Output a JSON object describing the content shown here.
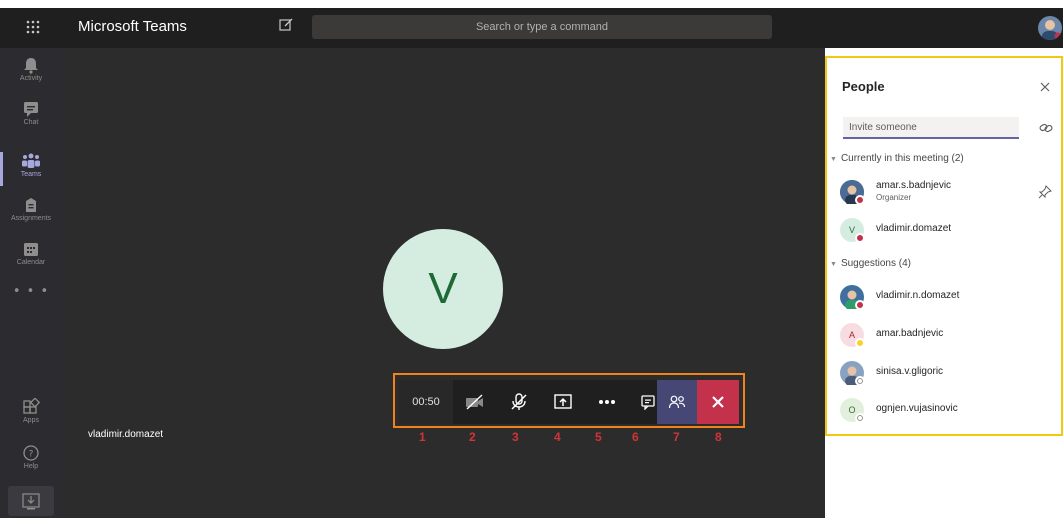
{
  "app": {
    "title": "Microsoft Teams",
    "search_placeholder": "Search or type a command"
  },
  "rail": {
    "items": [
      {
        "label": "Activity",
        "icon": "bell-icon"
      },
      {
        "label": "Chat",
        "icon": "chat-icon"
      },
      {
        "label": "Teams",
        "icon": "teams-icon",
        "active": true
      },
      {
        "label": "Assignments",
        "icon": "assignments-icon"
      },
      {
        "label": "Calendar",
        "icon": "calendar-icon"
      }
    ],
    "more": "• • •",
    "bottom": [
      {
        "label": "Apps",
        "icon": "apps-icon"
      },
      {
        "label": "Help",
        "icon": "help-icon"
      }
    ]
  },
  "stage": {
    "avatar_initial": "V",
    "participant_name": "vladimir.domazet"
  },
  "controls": {
    "timer": "00:50",
    "annotations": [
      "1",
      "2",
      "3",
      "4",
      "5",
      "6",
      "7",
      "8"
    ]
  },
  "people": {
    "title": "People",
    "invite_placeholder": "Invite someone",
    "in_meeting_header": "Currently in this meeting (2)",
    "in_meeting": [
      {
        "name": "amar.s.badnjevic",
        "role": "Organizer",
        "status": "busy"
      },
      {
        "name": "vladimir.domazet",
        "initial": "V",
        "status": "busy"
      }
    ],
    "suggestions_header": "Suggestions (4)",
    "suggestions": [
      {
        "name": "vladimir.n.domazet",
        "status": "busy"
      },
      {
        "name": "amar.badnjevic",
        "initial": "A",
        "status": "away"
      },
      {
        "name": "sinisa.v.gligoric",
        "status": "offline"
      },
      {
        "name": "ognjen.vujasinovic",
        "initial": "O",
        "status": "offline"
      }
    ]
  },
  "colors": {
    "accent": "#6264a7",
    "hangup": "#c4314b",
    "busy": "#c4314b",
    "away": "#f8d22a",
    "controls_outline": "#f0831c",
    "panel_outline": "#f2c811",
    "annotation": "#d13438"
  }
}
